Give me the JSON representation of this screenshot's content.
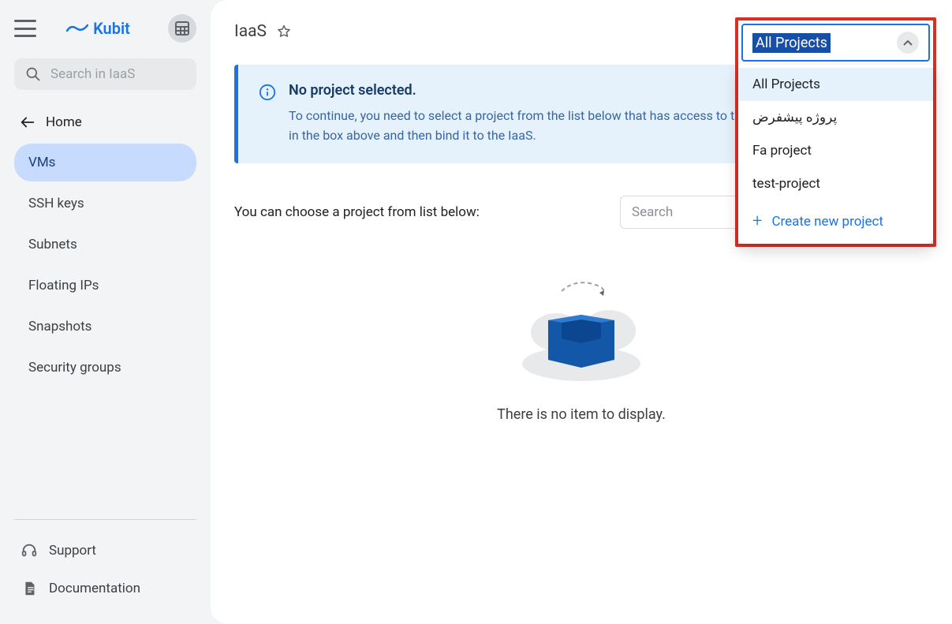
{
  "brand": "Kubit",
  "sidebar": {
    "search_placeholder": "Search in IaaS",
    "back_label": "Home",
    "items": [
      {
        "label": "VMs",
        "active": true
      },
      {
        "label": "SSH keys",
        "active": false
      },
      {
        "label": "Subnets",
        "active": false
      },
      {
        "label": "Floating IPs",
        "active": false
      },
      {
        "label": "Snapshots",
        "active": false
      },
      {
        "label": "Security groups",
        "active": false
      }
    ],
    "footer": {
      "support": "Support",
      "docs": "Documentation"
    }
  },
  "header": {
    "title": "IaaS"
  },
  "alert": {
    "title": "No project selected.",
    "text": "To continue, you need to select a project from the list below that has access to the choose one of the projects in the box above and then bind it to the IaaS."
  },
  "list": {
    "label": "You can choose a project from list below:",
    "search_placeholder": "Search"
  },
  "empty_text": "There is no item to display.",
  "dropdown": {
    "selected": "All Projects",
    "options": [
      "All Projects",
      "پروژه پیشفرض",
      "Fa project",
      "test-project"
    ],
    "create": "Create new project"
  }
}
